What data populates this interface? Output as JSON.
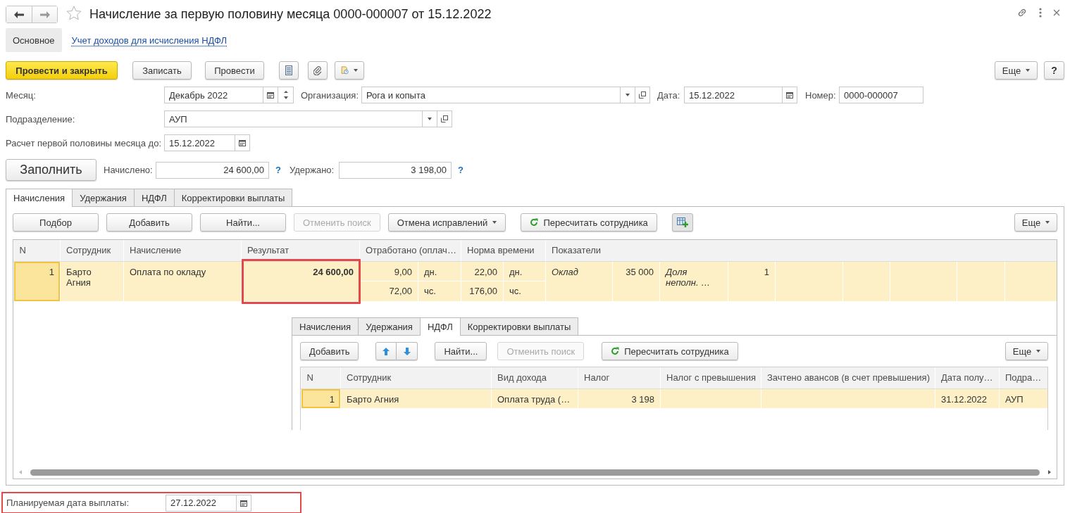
{
  "window": {
    "title": "Начисление за первую половину месяца 0000-000007 от 15.12.2022"
  },
  "nav_tabs": [
    {
      "label": "Основное",
      "selected": true
    },
    {
      "label": "Учет доходов для исчисления НДФЛ",
      "selected": false
    }
  ],
  "toolbar": {
    "buttons": [
      {
        "label": "Провести и закрыть",
        "kind": "primary"
      },
      {
        "label": "Записать",
        "kind": "plain"
      },
      {
        "label": "Провести",
        "kind": "plain"
      }
    ],
    "more": "Еще",
    "help": "?"
  },
  "header_fields": {
    "month": {
      "label": "Месяц:",
      "value": "Декабрь 2022"
    },
    "organization": {
      "label": "Организация:",
      "value": "Рога и копыта"
    },
    "date": {
      "label": "Дата:",
      "value": "15.12.2022"
    },
    "number": {
      "label": "Номер:",
      "value": "0000-000007"
    },
    "department": {
      "label": "Подразделение:",
      "value": "АУП"
    },
    "calc_until": {
      "label": "Расчет первой половины месяца до:",
      "value": "15.12.2022"
    }
  },
  "fill_button": "Заполнить",
  "totals": [
    {
      "label": "Начислено:",
      "value": "24 600,00",
      "hint": "?"
    },
    {
      "label": "Удержано:",
      "value": "3 198,00",
      "hint": "?"
    }
  ],
  "tabs": [
    {
      "label": "Начисления",
      "selected": true
    },
    {
      "label": "Удержания",
      "selected": false
    },
    {
      "label": "НДФЛ",
      "selected": false
    },
    {
      "label": "Корректировки выплаты",
      "selected": false
    }
  ],
  "accruals": {
    "toolbar": [
      {
        "label": "Подбор",
        "kind": "plain",
        "disabled": false
      },
      {
        "label": "Добавить",
        "kind": "plain",
        "disabled": false
      },
      {
        "label": "Найти...",
        "kind": "plain",
        "disabled": false
      },
      {
        "label": "Отменить поиск",
        "kind": "plain",
        "disabled": true
      },
      {
        "label": "Отмена исправлений",
        "kind": "menu",
        "disabled": false
      },
      {
        "label": "Пересчитать сотрудника",
        "kind": "refresh",
        "disabled": false
      }
    ],
    "more": "Еще",
    "columns": [
      "N",
      "Сотрудник",
      "Начисление",
      "Результат",
      "Отработано (оплач…",
      "Норма времени",
      "Показатели"
    ],
    "rows": [
      {
        "selected": true,
        "n": "1",
        "employee": "Барто Агния",
        "accrual": "Оплата по окладу",
        "result": "24 600,00",
        "result_highlighted": true,
        "worked": [
          {
            "value": "9,00",
            "unit": "дн."
          },
          {
            "value": "72,00",
            "unit": "чс."
          }
        ],
        "norm": [
          {
            "value": "22,00",
            "unit": "дн."
          },
          {
            "value": "176,00",
            "unit": "чс."
          }
        ],
        "indicators": [
          {
            "name": "Оклад",
            "value": "35 000"
          },
          {
            "name": "Доля неполн. …",
            "value": "1"
          }
        ]
      }
    ]
  },
  "ndfl_panel": {
    "tabs": [
      {
        "label": "Начисления",
        "selected": false
      },
      {
        "label": "Удержания",
        "selected": false
      },
      {
        "label": "НДФЛ",
        "selected": true
      },
      {
        "label": "Корректировки выплаты",
        "selected": false
      }
    ],
    "toolbar": [
      {
        "label": "Добавить",
        "kind": "plain",
        "disabled": false
      },
      {
        "kind": "arrows",
        "disabled": false
      },
      {
        "label": "Найти...",
        "kind": "plain",
        "disabled": false
      },
      {
        "label": "Отменить поиск",
        "kind": "plain",
        "disabled": true
      },
      {
        "label": "Пересчитать сотрудника",
        "kind": "refresh",
        "disabled": false
      }
    ],
    "more": "Еще",
    "columns": [
      "N",
      "Сотрудник",
      "Вид дохода",
      "Налог",
      "Налог с превышения",
      "Зачтено авансов (в счет превышения)",
      "Дата полу…",
      "Подра…"
    ],
    "rows": [
      {
        "selected": true,
        "n": "1",
        "employee": "Барто Агния",
        "income_type": "Оплата труда (…",
        "tax": "3 198",
        "date": "31.12.2022",
        "department": "АУП"
      }
    ]
  },
  "footer": {
    "label": "Планируемая дата выплаты:",
    "value": "27.12.2022",
    "highlighted": true
  }
}
